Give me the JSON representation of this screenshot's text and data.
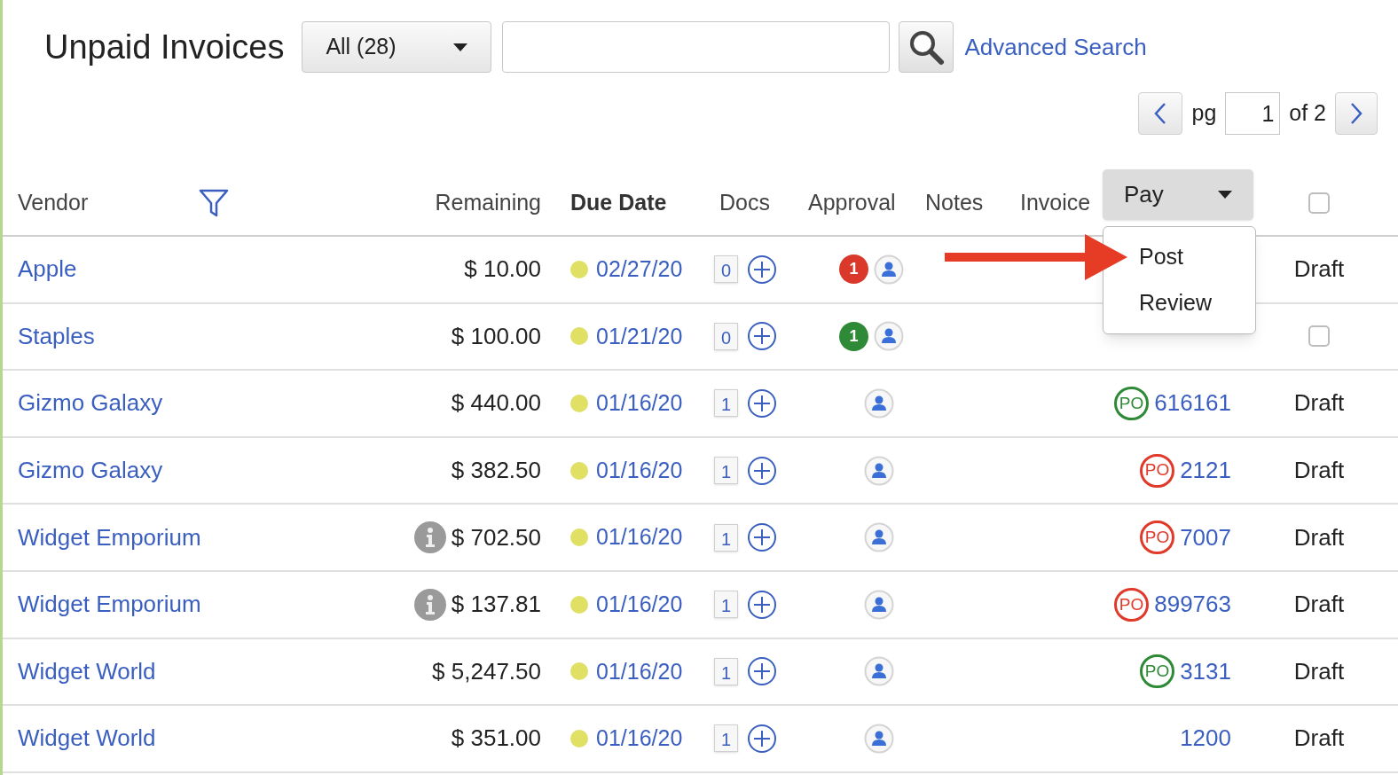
{
  "title": "Unpaid Invoices",
  "filter_select": {
    "value": "All (28)"
  },
  "advanced_search": "Advanced Search",
  "pager": {
    "label": "pg",
    "page": "1",
    "of": "of 2"
  },
  "columns": [
    {
      "label": "Vendor",
      "sorted": false
    },
    {
      "label": "Remaining",
      "sorted": false
    },
    {
      "label": "Due Date",
      "sorted": true
    },
    {
      "label": "Docs",
      "sorted": false
    },
    {
      "label": "Approval",
      "sorted": false
    },
    {
      "label": "Notes",
      "sorted": false
    },
    {
      "label": "Invoice",
      "sorted": false
    }
  ],
  "pay_menu": {
    "label": "Pay",
    "expanded": true,
    "options": [
      "Post",
      "Review"
    ]
  },
  "header_checkbox": {
    "checked": false
  },
  "rows": [
    {
      "vendor": "Apple",
      "remaining": "$ 10.00",
      "info": false,
      "due": "02/27/20",
      "docs": "0",
      "approval": {
        "count": "1",
        "color": "#d9382a"
      },
      "status": {
        "kind": "text",
        "text": "Draft"
      }
    },
    {
      "vendor": "Staples",
      "remaining": "$ 100.00",
      "info": false,
      "due": "01/21/20",
      "docs": "0",
      "approval": {
        "count": "1",
        "color": "#2e8a36"
      },
      "status": {
        "kind": "checkbox",
        "checked": false
      }
    },
    {
      "vendor": "Gizmo Galaxy",
      "remaining": "$ 440.00",
      "info": false,
      "due": "01/16/20",
      "docs": "1",
      "invoice": {
        "po": {
          "text": "PO",
          "color": "#2e8a36"
        },
        "number": "616161"
      },
      "status": {
        "kind": "text",
        "text": "Draft"
      }
    },
    {
      "vendor": "Gizmo Galaxy",
      "remaining": "$ 382.50",
      "info": false,
      "due": "01/16/20",
      "docs": "1",
      "invoice": {
        "po": {
          "text": "PO",
          "color": "#e03a2a"
        },
        "number": "2121"
      },
      "status": {
        "kind": "text",
        "text": "Draft"
      }
    },
    {
      "vendor": "Widget Emporium",
      "remaining": "$ 702.50",
      "info": true,
      "due": "01/16/20",
      "docs": "1",
      "invoice": {
        "po": {
          "text": "PO",
          "color": "#e03a2a"
        },
        "number": "7007"
      },
      "status": {
        "kind": "text",
        "text": "Draft"
      }
    },
    {
      "vendor": "Widget Emporium",
      "remaining": "$ 137.81",
      "info": true,
      "due": "01/16/20",
      "docs": "1",
      "invoice": {
        "po": {
          "text": "PO",
          "color": "#e03a2a"
        },
        "number": "899763"
      },
      "status": {
        "kind": "text",
        "text": "Draft"
      }
    },
    {
      "vendor": "Widget World",
      "remaining": "$ 5,247.50",
      "info": false,
      "due": "01/16/20",
      "docs": "1",
      "invoice": {
        "po": {
          "text": "PO",
          "color": "#2e8a36"
        },
        "number": "3131"
      },
      "status": {
        "kind": "text",
        "text": "Draft"
      }
    },
    {
      "vendor": "Widget World",
      "remaining": "$ 351.00",
      "info": false,
      "due": "01/16/20",
      "docs": "1",
      "invoice": {
        "number": "1200"
      },
      "status": {
        "kind": "text",
        "text": "Draft"
      }
    }
  ]
}
